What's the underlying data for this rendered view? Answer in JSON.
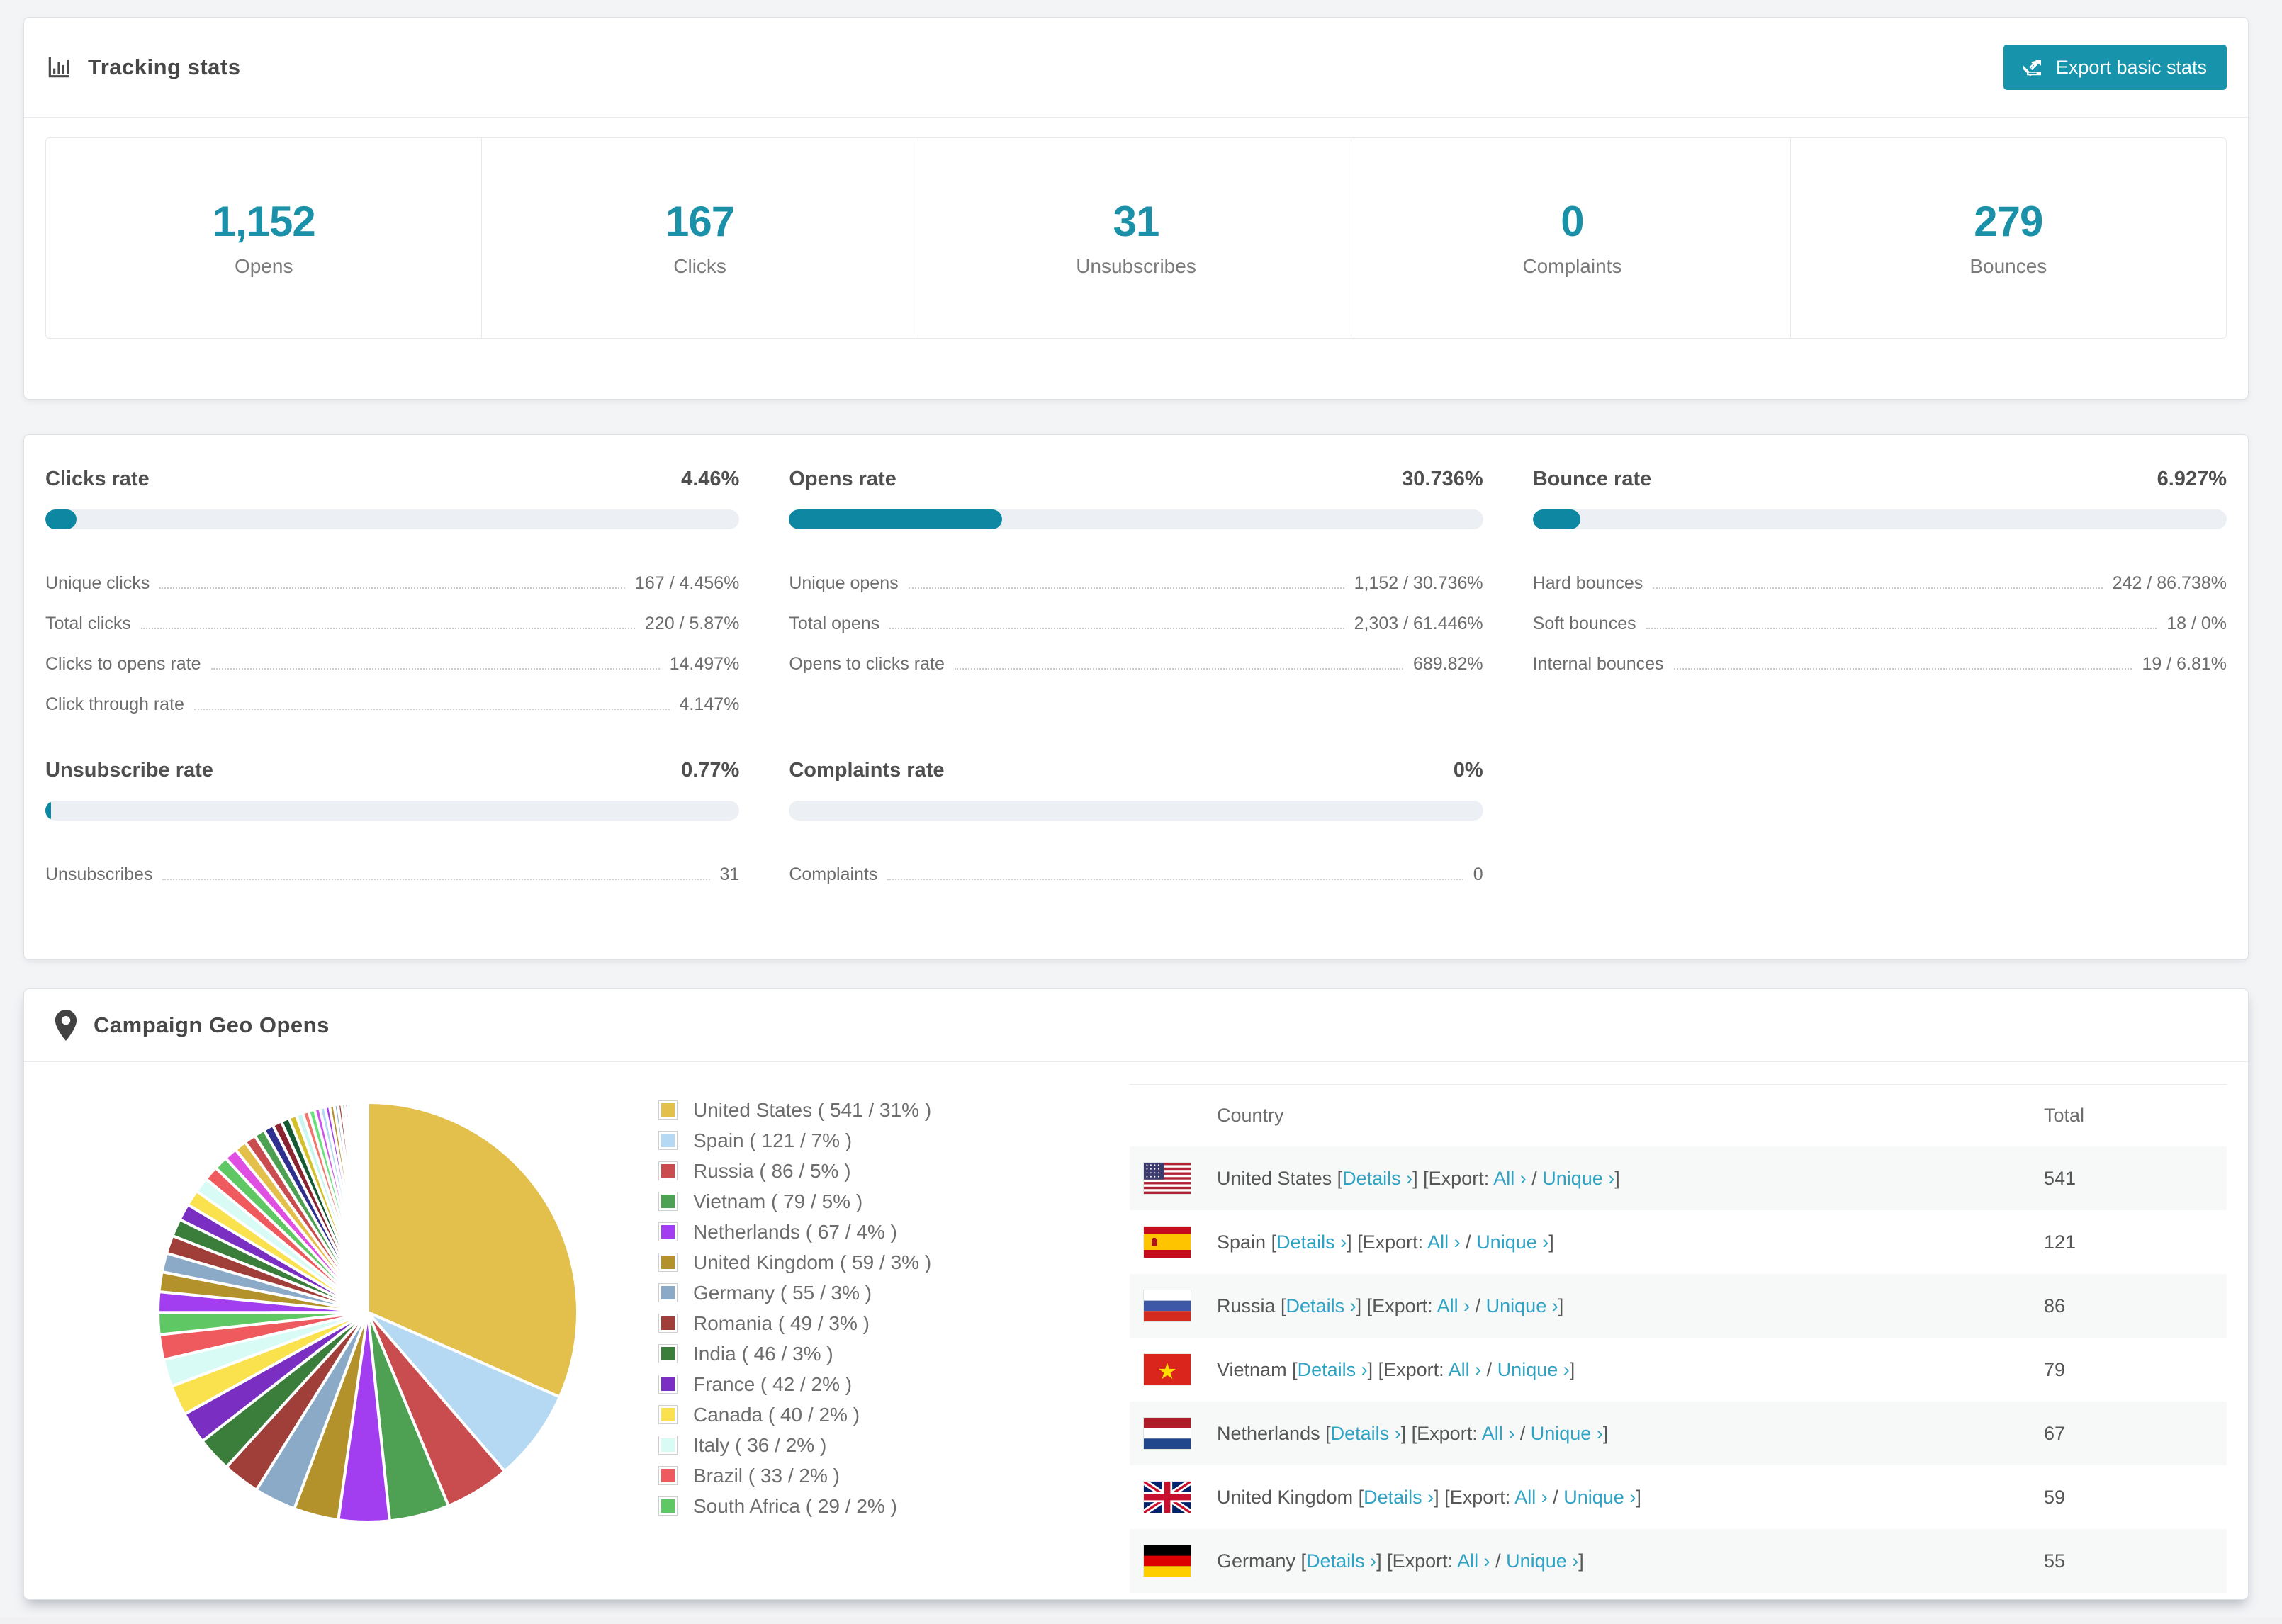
{
  "tracking": {
    "title": "Tracking stats",
    "export_button": "Export basic stats",
    "summary": [
      {
        "value": "1,152",
        "label": "Opens"
      },
      {
        "value": "167",
        "label": "Clicks"
      },
      {
        "value": "31",
        "label": "Unsubscribes"
      },
      {
        "value": "0",
        "label": "Complaints"
      },
      {
        "value": "279",
        "label": "Bounces"
      }
    ]
  },
  "rates": [
    {
      "id": "clicks-rate",
      "title": "Clicks rate",
      "percent": "4.46%",
      "bar_pct": 4.46,
      "rows": [
        {
          "label": "Unique clicks",
          "value": "167 / 4.456%"
        },
        {
          "label": "Total clicks",
          "value": "220 / 5.87%"
        },
        {
          "label": "Clicks to opens rate",
          "value": "14.497%"
        },
        {
          "label": "Click through rate",
          "value": "4.147%"
        }
      ]
    },
    {
      "id": "opens-rate",
      "title": "Opens rate",
      "percent": "30.736%",
      "bar_pct": 30.736,
      "rows": [
        {
          "label": "Unique opens",
          "value": "1,152 / 30.736%"
        },
        {
          "label": "Total opens",
          "value": "2,303 / 61.446%"
        },
        {
          "label": "Opens to clicks rate",
          "value": "689.82%"
        }
      ]
    },
    {
      "id": "bounce-rate",
      "title": "Bounce rate",
      "percent": "6.927%",
      "bar_pct": 6.927,
      "rows": [
        {
          "label": "Hard bounces",
          "value": "242 / 86.738%"
        },
        {
          "label": "Soft bounces",
          "value": "18 / 0%"
        },
        {
          "label": "Internal bounces",
          "value": "19 / 6.81%"
        }
      ]
    },
    {
      "id": "unsubscribe-rate",
      "title": "Unsubscribe rate",
      "percent": "0.77%",
      "bar_pct": 0.77,
      "rows": [
        {
          "label": "Unsubscribes",
          "value": "31"
        }
      ]
    },
    {
      "id": "complaints-rate",
      "title": "Complaints rate",
      "percent": "0%",
      "bar_pct": 0,
      "rows": [
        {
          "label": "Complaints",
          "value": "0"
        }
      ]
    }
  ],
  "geo": {
    "title": "Campaign Geo Opens",
    "table": {
      "col_country": "Country",
      "col_total": "Total",
      "details_label": "Details ›",
      "export_label": "Export:",
      "all_label": "All ›",
      "unique_label": "Unique ›",
      "rows": [
        {
          "country": "United States",
          "flag": "us",
          "total": "541"
        },
        {
          "country": "Spain",
          "flag": "es",
          "total": "121"
        },
        {
          "country": "Russia",
          "flag": "ru",
          "total": "86"
        },
        {
          "country": "Vietnam",
          "flag": "vn",
          "total": "79"
        },
        {
          "country": "Netherlands",
          "flag": "nl",
          "total": "67"
        },
        {
          "country": "United Kingdom",
          "flag": "gb",
          "total": "59"
        },
        {
          "country": "Germany",
          "flag": "de",
          "total": "55"
        }
      ]
    }
  },
  "chart_data": {
    "type": "pie",
    "title": "Campaign Geo Opens",
    "legend_position": "right",
    "start_angle": "top",
    "direction": "clockwise",
    "series": [
      {
        "label": "United States",
        "value": 541,
        "pct": "31",
        "color": "#e3bf4b"
      },
      {
        "label": "Spain",
        "value": 121,
        "pct": "7",
        "color": "#b5d9f2"
      },
      {
        "label": "Russia",
        "value": 86,
        "pct": "5",
        "color": "#c94c4e"
      },
      {
        "label": "Vietnam",
        "value": 79,
        "pct": "5",
        "color": "#4ea152"
      },
      {
        "label": "Netherlands",
        "value": 67,
        "pct": "4",
        "color": "#a23df0"
      },
      {
        "label": "United Kingdom",
        "value": 59,
        "pct": "3",
        "color": "#b3912b"
      },
      {
        "label": "Germany",
        "value": 55,
        "pct": "3",
        "color": "#8aaac8"
      },
      {
        "label": "Romania",
        "value": 49,
        "pct": "3",
        "color": "#a03e3a"
      },
      {
        "label": "India",
        "value": 46,
        "pct": "3",
        "color": "#3b7e3c"
      },
      {
        "label": "France",
        "value": 42,
        "pct": "2",
        "color": "#7a2fc2"
      },
      {
        "label": "Canada",
        "value": 40,
        "pct": "2",
        "color": "#fae14e"
      },
      {
        "label": "Italy",
        "value": 36,
        "pct": "2",
        "color": "#d8fbf5"
      },
      {
        "label": "Brazil",
        "value": 33,
        "pct": "2",
        "color": "#ef5a5e"
      },
      {
        "label": "South Africa",
        "value": 29,
        "pct": "2",
        "color": "#5fc764"
      }
    ],
    "unlabeled_tail_estimated": [
      27,
      26,
      25,
      24,
      23,
      22,
      21,
      20,
      19,
      18,
      17,
      16,
      15,
      14,
      13,
      12,
      11,
      10,
      9,
      8,
      8,
      7,
      7,
      6,
      6,
      5,
      5,
      4,
      4,
      3,
      3,
      3,
      2,
      2,
      2,
      2,
      1,
      1,
      1,
      1,
      1,
      1,
      1,
      1,
      1
    ],
    "tail_palette": [
      "#a23df0",
      "#b3912b",
      "#8aaac8",
      "#a03e3a",
      "#3b7e3c",
      "#7a2fc2",
      "#fae14e",
      "#d8fbf5",
      "#ef5a5e",
      "#5fc764",
      "#df4fe2",
      "#e3bf4b",
      "#c94c4e",
      "#4ea152",
      "#2f2f8f",
      "#8a2430",
      "#145a32",
      "#d4c02a",
      "#c8f7f0",
      "#f2766b",
      "#69e07a",
      "#cf53e8",
      "#b5d9f2"
    ]
  },
  "colors": {
    "accent_teal": "#1793ab",
    "bar_fill": "#0e88a2",
    "link_teal": "#2fa3c4"
  }
}
